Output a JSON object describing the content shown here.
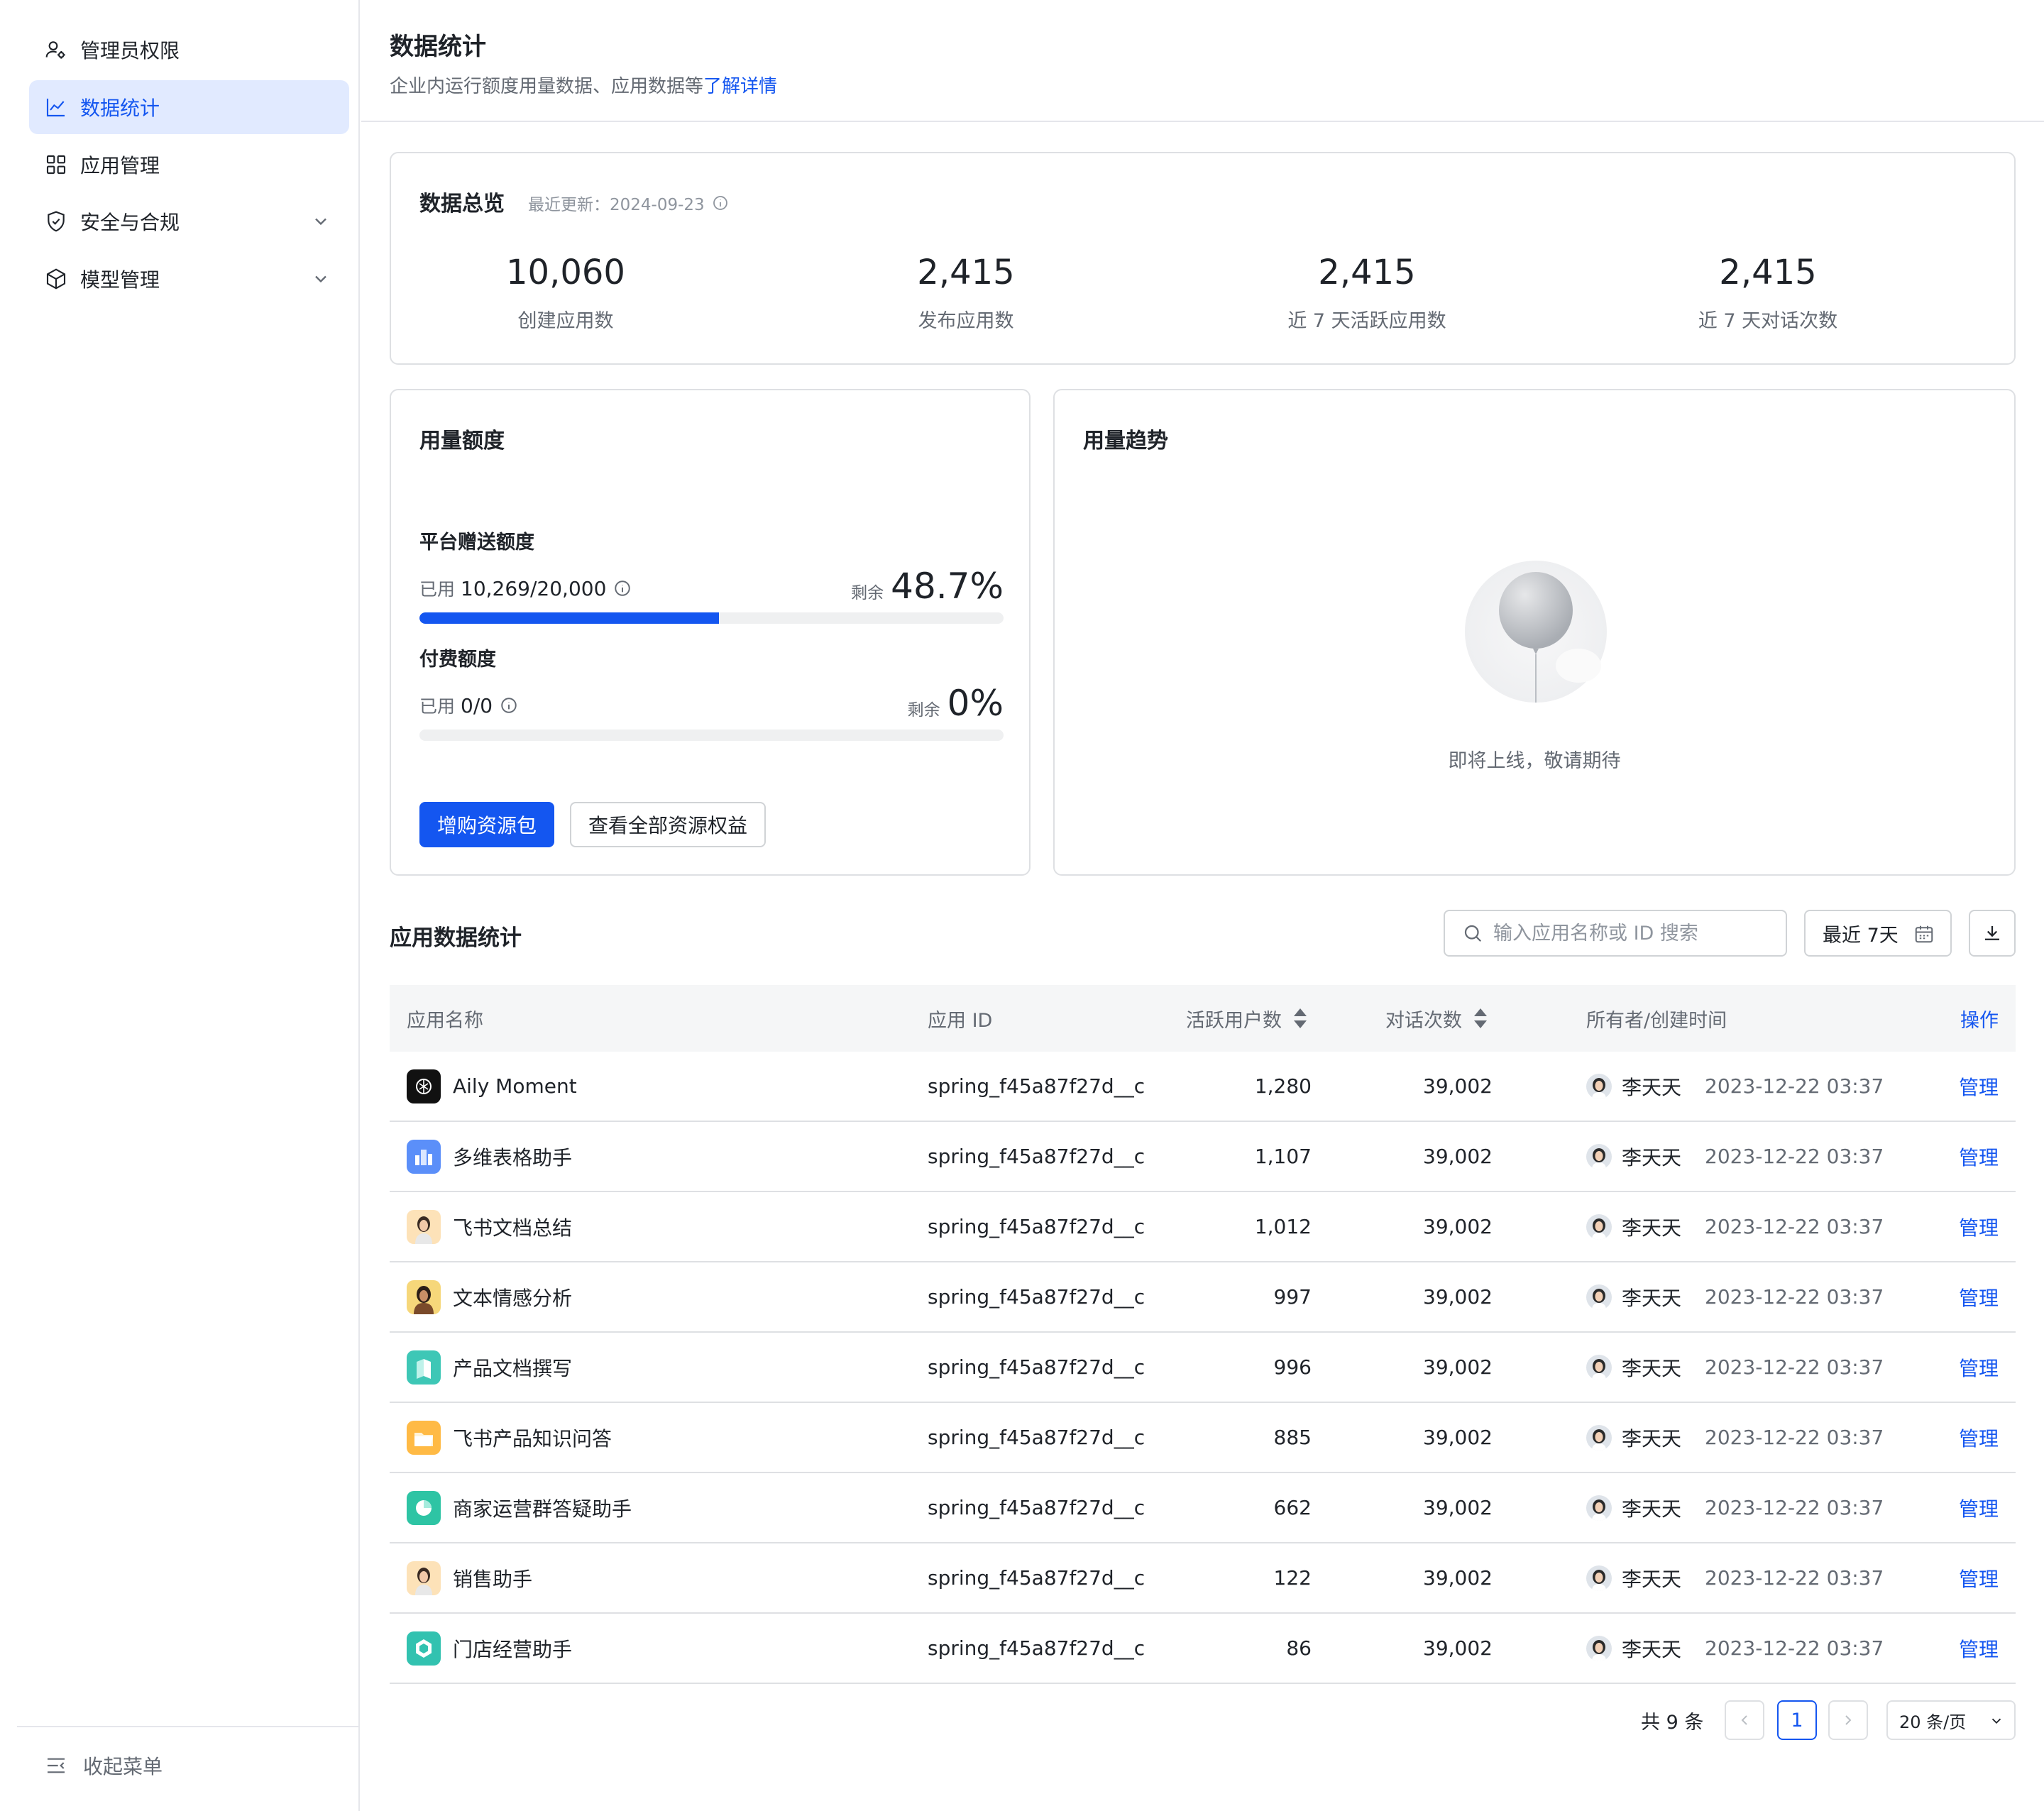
{
  "sidebar": {
    "items": [
      {
        "label": "管理员权限",
        "icon": "user-settings-icon"
      },
      {
        "label": "数据统计",
        "icon": "line-chart-icon",
        "active": true
      },
      {
        "label": "应用管理",
        "icon": "grid-icon"
      },
      {
        "label": "安全与合规",
        "icon": "shield-icon"
      },
      {
        "label": "模型管理",
        "icon": "cube-icon"
      }
    ],
    "collapse_label": "收起菜单"
  },
  "header": {
    "title": "数据统计",
    "desc": "企业内运行额度用量数据、应用数据等",
    "link": "了解详情"
  },
  "overview": {
    "title": "数据总览",
    "update_label": "最近更新：2024-09-23",
    "stats": [
      {
        "value": "10,060",
        "label": "创建应用数"
      },
      {
        "value": "2,415",
        "label": "发布应用数"
      },
      {
        "value": "2,415",
        "label": "近 7 天活跃应用数"
      },
      {
        "value": "2,415",
        "label": "近 7 天对话次数"
      }
    ]
  },
  "quota": {
    "title": "用量额度",
    "platform": {
      "name": "平台赠送额度",
      "used_label": "已用",
      "used": "10,269/20,000",
      "left_label": "剩余",
      "left": "48.7%",
      "used_fraction": 0.513
    },
    "paid": {
      "name": "付费额度",
      "used_label": "已用",
      "used": "0/0",
      "left_label": "剩余",
      "left": "0%",
      "used_fraction": 0
    },
    "buy_button": "增购资源包",
    "view_button": "查看全部资源权益"
  },
  "trend": {
    "title": "用量趋势",
    "empty_text": "即将上线，敬请期待"
  },
  "table_section": {
    "title": "应用数据统计",
    "search_placeholder": "输入应用名称或 ID 搜索",
    "date_range": "最近 7天",
    "columns": {
      "name": "应用名称",
      "id": "应用 ID",
      "active": "活跃用户数",
      "conv": "对话次数",
      "owner": "所有者/创建时间",
      "op": "操作"
    },
    "rows": [
      {
        "name": "Aily Moment",
        "id": "spring_f45a87f27d__c",
        "active": "1,280",
        "conv": "39,002",
        "owner": "李天天",
        "time": "2023-12-22 03:37",
        "op": "管理",
        "icon": "black"
      },
      {
        "name": "多维表格助手",
        "id": "spring_f45a87f27d__c",
        "active": "1,107",
        "conv": "39,002",
        "owner": "李天天",
        "time": "2023-12-22 03:37",
        "op": "管理",
        "icon": "blue"
      },
      {
        "name": "飞书文档总结",
        "id": "spring_f45a87f27d__c",
        "active": "1,012",
        "conv": "39,002",
        "owner": "李天天",
        "time": "2023-12-22 03:37",
        "op": "管理",
        "icon": "person"
      },
      {
        "name": "文本情感分析",
        "id": "spring_f45a87f27d__c",
        "active": "997",
        "conv": "39,002",
        "owner": "李天天",
        "time": "2023-12-22 03:37",
        "op": "管理",
        "icon": "person2"
      },
      {
        "name": "产品文档撰写",
        "id": "spring_f45a87f27d__c",
        "active": "996",
        "conv": "39,002",
        "owner": "李天天",
        "time": "2023-12-22 03:37",
        "op": "管理",
        "icon": "teal"
      },
      {
        "name": "飞书产品知识问答",
        "id": "spring_f45a87f27d__c",
        "active": "885",
        "conv": "39,002",
        "owner": "李天天",
        "time": "2023-12-22 03:37",
        "op": "管理",
        "icon": "orange"
      },
      {
        "name": "商家运营群答疑助手",
        "id": "spring_f45a87f27d__c",
        "active": "662",
        "conv": "39,002",
        "owner": "李天天",
        "time": "2023-12-22 03:37",
        "op": "管理",
        "icon": "pie"
      },
      {
        "name": "销售助手",
        "id": "spring_f45a87f27d__c",
        "active": "122",
        "conv": "39,002",
        "owner": "李天天",
        "time": "2023-12-22 03:37",
        "op": "管理",
        "icon": "person"
      },
      {
        "name": "门店经营助手",
        "id": "spring_f45a87f27d__c",
        "active": "86",
        "conv": "39,002",
        "owner": "李天天",
        "time": "2023-12-22 03:37",
        "op": "管理",
        "icon": "hex"
      }
    ]
  },
  "pagination": {
    "total": "共 9 条",
    "page": "1",
    "page_size": "20 条/页"
  },
  "colors": {
    "primary": "#1456f0",
    "active_bg": "#e1eaff"
  }
}
